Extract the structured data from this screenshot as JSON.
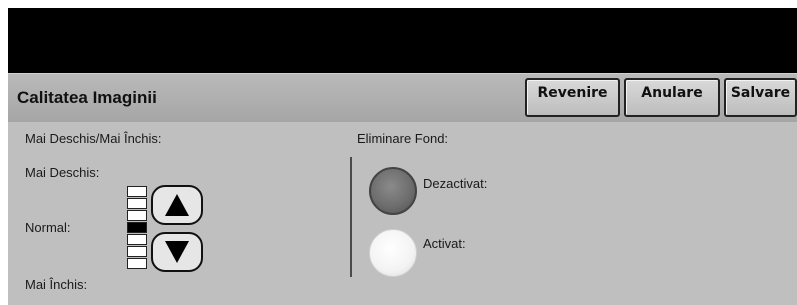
{
  "header": {
    "title": "Calitatea Imaginii",
    "buttons": {
      "revert": "Revenire",
      "cancel": "Anulare",
      "save": "Salvare"
    }
  },
  "lighten_darken": {
    "section_label": "Mai Deschis/Mai Închis:",
    "lighter_label": "Mai Deschis:",
    "normal_label": "Normal:",
    "darker_label": "Mai Închis:",
    "levels_total": 7,
    "selected_level": 4
  },
  "background_suppression": {
    "section_label": "Eliminare Fond:",
    "options": [
      {
        "label": "Dezactivat:",
        "selected": true
      },
      {
        "label": "Activat:",
        "selected": false
      }
    ]
  },
  "colors": {
    "top_bar": "#000000",
    "panel": "#bfbfbf",
    "header": "#b0b0b0"
  }
}
